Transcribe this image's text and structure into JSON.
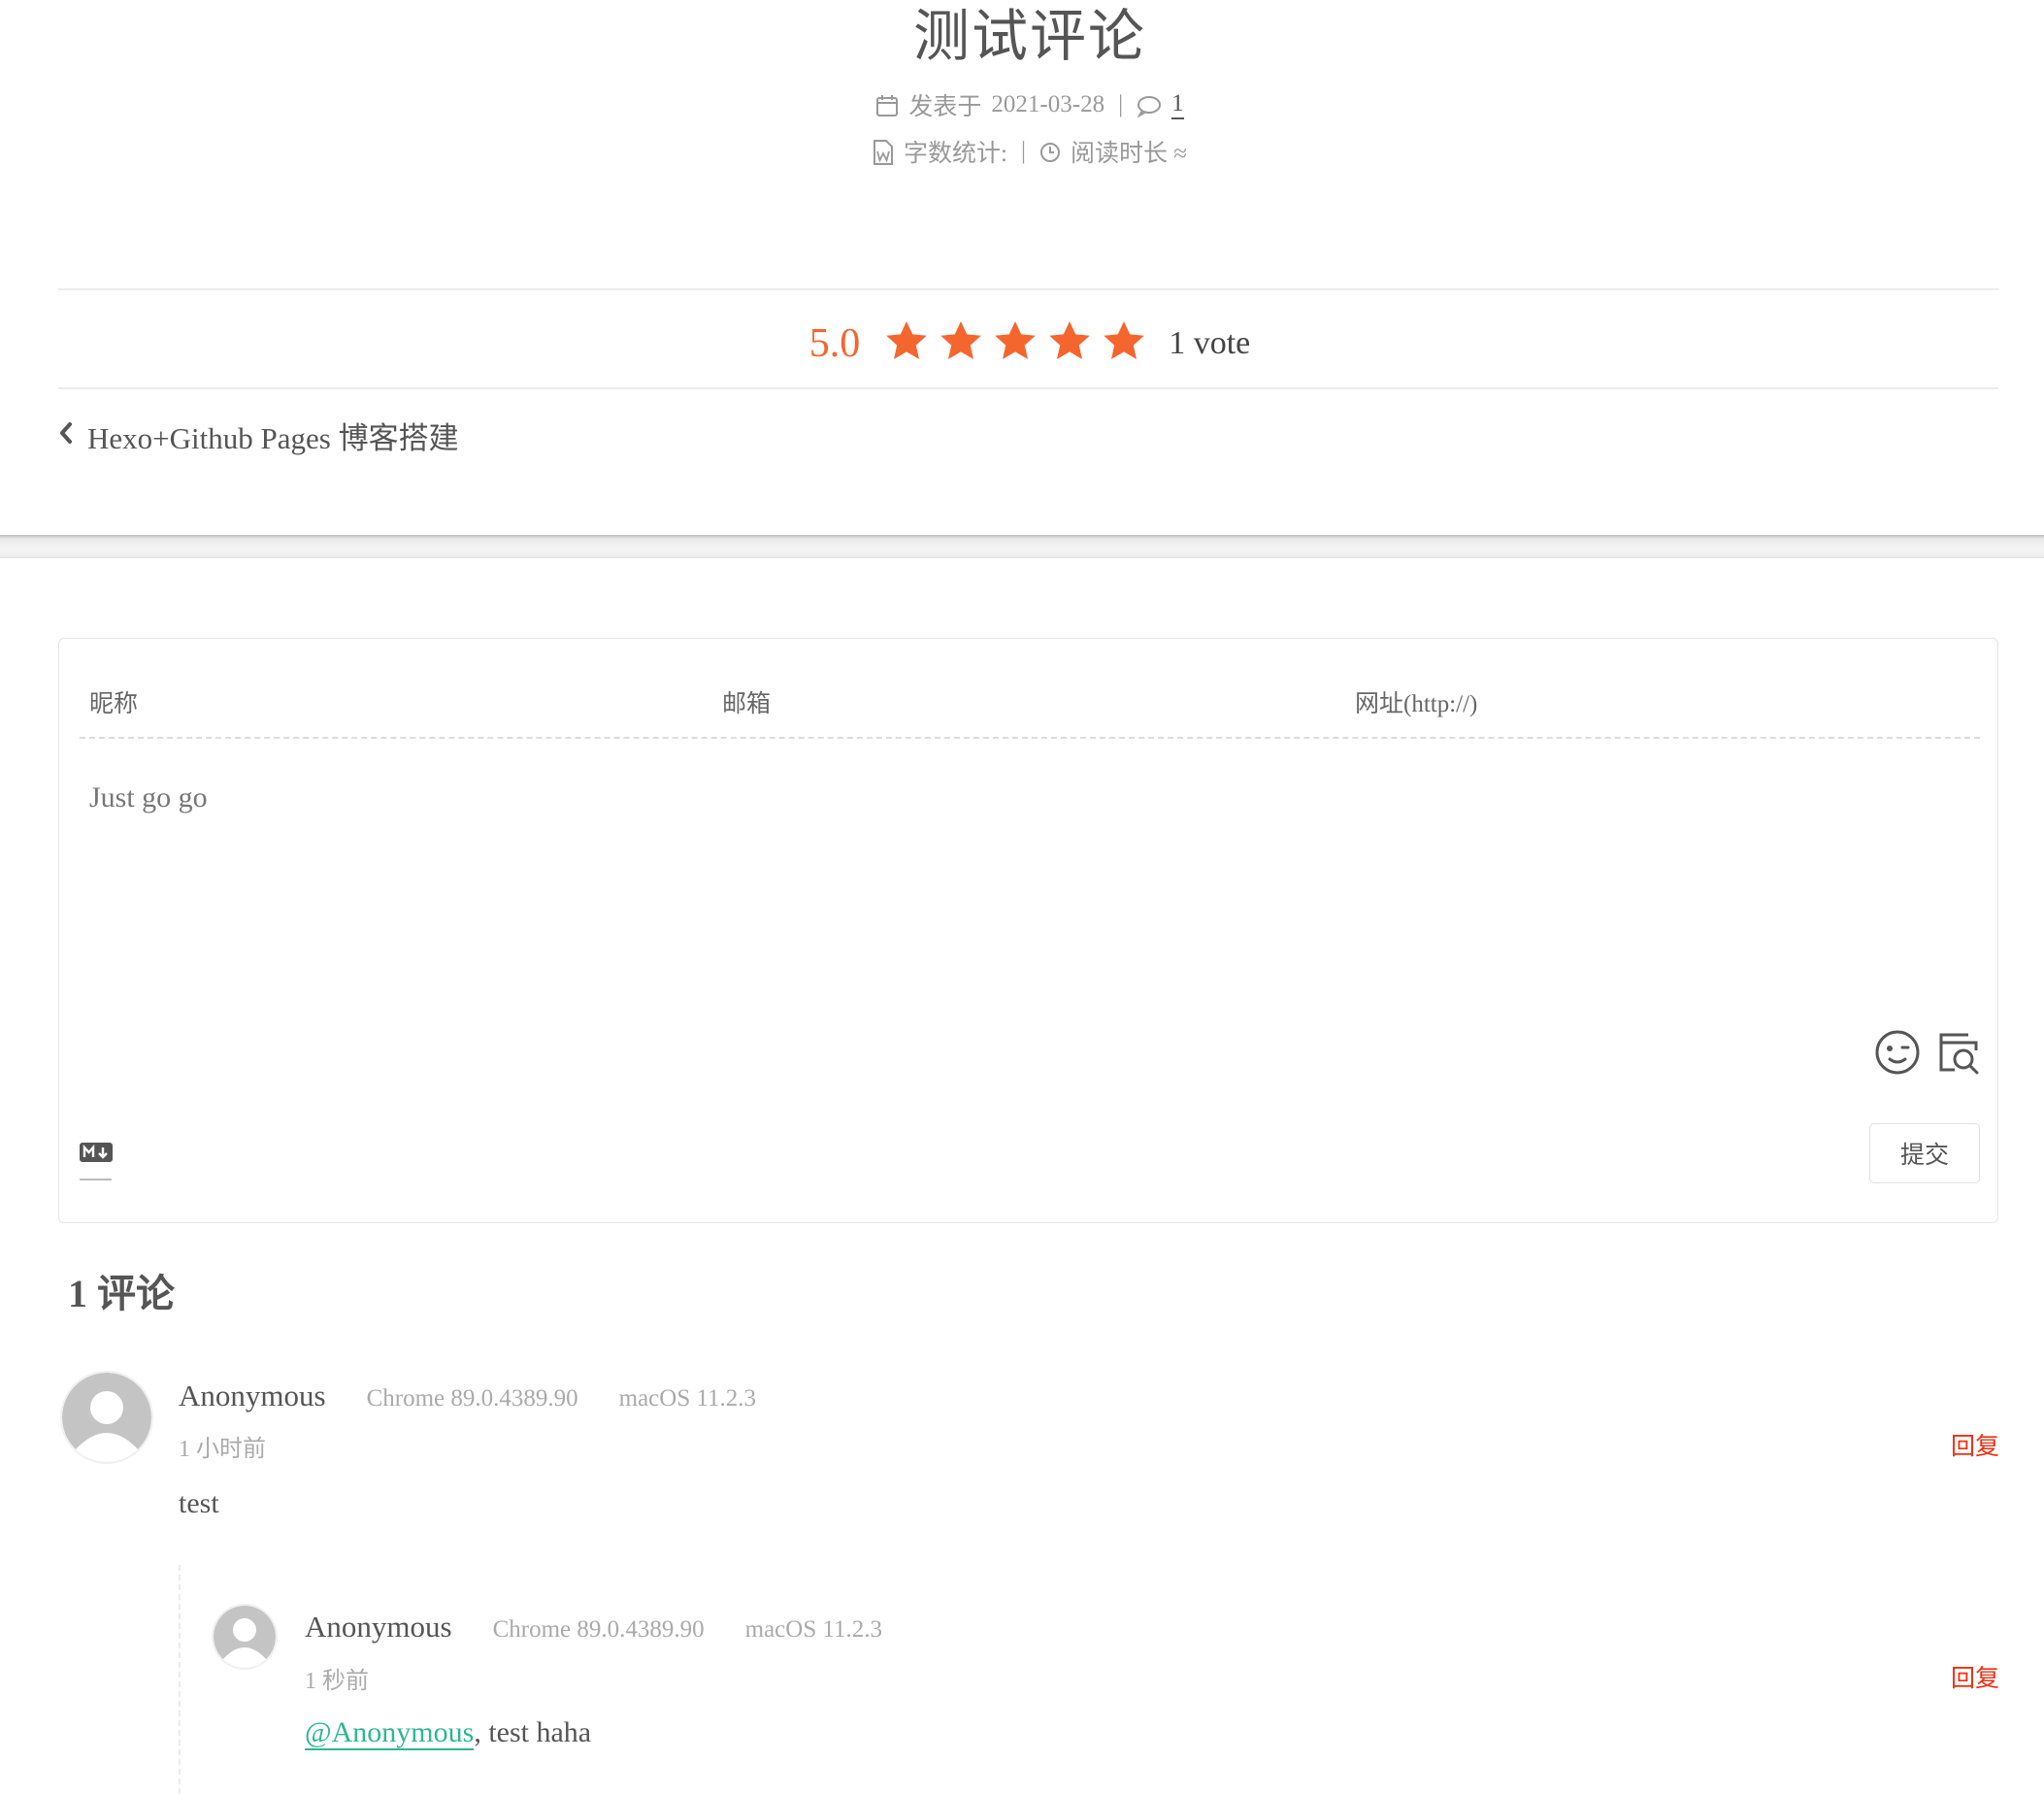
{
  "post": {
    "title": "测试评论",
    "published_label": "发表于",
    "published_date": "2021-03-28",
    "comment_count_link": "1",
    "word_count_label": "字数统计:",
    "reading_time_label": "阅读时长 ≈"
  },
  "rating": {
    "score": "5.0",
    "stars": 5,
    "votes_label": "1 vote",
    "star_color": "#f5652e"
  },
  "nav": {
    "prev_post": "Hexo+Github Pages 博客搭建"
  },
  "comment_form": {
    "nickname_placeholder": "昵称",
    "email_placeholder": "邮箱",
    "url_placeholder": "网址(http://)",
    "textarea_placeholder": "Just go go",
    "submit_label": "提交",
    "icons": [
      "emoji-icon",
      "preview-icon",
      "markdown-icon"
    ]
  },
  "comments_section": {
    "count_title": "1 评论",
    "comments": [
      {
        "author": "Anonymous",
        "browser": "Chrome 89.0.4389.90",
        "os": "macOS 11.2.3",
        "time": "1 小时前",
        "reply_label": "回复",
        "text": "test",
        "replies": [
          {
            "author": "Anonymous",
            "browser": "Chrome 89.0.4389.90",
            "os": "macOS 11.2.3",
            "time": "1 秒前",
            "reply_label": "回复",
            "mention": "@Anonymous",
            "text": ", test haha"
          }
        ]
      }
    ]
  },
  "colors": {
    "accent_orange": "#f5652e",
    "reply_red": "#ef2f11",
    "mention_green": "#2db696"
  }
}
